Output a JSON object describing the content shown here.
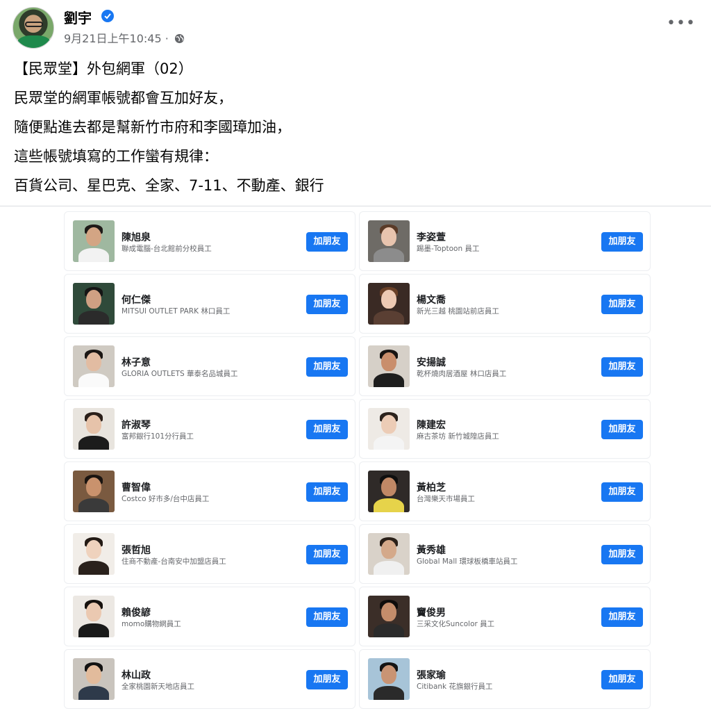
{
  "post": {
    "author": "劉宇",
    "timestamp": "9月21日上午10:45 ·",
    "lines": [
      "【民眾堂】外包網軍（02）",
      "民眾堂的網軍帳號都會互加好友，",
      "隨便點進去都是幫新竹市府和李國璋加油，",
      "這些帳號填寫的工作蠻有規律：",
      "百貨公司、星巴克、全家、7-11、不動產、銀行"
    ]
  },
  "colors": {
    "accent": "#1877f2",
    "text": "#050505",
    "muted": "#65676b"
  },
  "icons": {
    "verified": "verified-badge-icon",
    "privacy": "globe-icon",
    "menu": "more-options-icon"
  },
  "friends": [
    {
      "name": "陳旭泉",
      "job": "聯成電腦-台北館前分校員工",
      "button": "加朋友"
    },
    {
      "name": "李姿萱",
      "job": "踢墨-Toptoon 員工",
      "button": "加朋友"
    },
    {
      "name": "何仁傑",
      "job": "MITSUI OUTLET PARK 林口員工",
      "button": "加朋友"
    },
    {
      "name": "楊文喬",
      "job": "新光三越 桃園站前店員工",
      "button": "加朋友"
    },
    {
      "name": "林子意",
      "job": "GLORIA OUTLETS 華泰名品城員工",
      "button": "加朋友"
    },
    {
      "name": "安揚誠",
      "job": "乾杯燒肉居酒屋 林口店員工",
      "button": "加朋友"
    },
    {
      "name": "許淑琴",
      "job": "富邦銀行101分行員工",
      "button": "加朋友"
    },
    {
      "name": "陳建宏",
      "job": "麻古茶坊 新竹城隍店員工",
      "button": "加朋友"
    },
    {
      "name": "曹智偉",
      "job": "Costco 好市多/台中店員工",
      "button": "加朋友"
    },
    {
      "name": "黃柏芝",
      "job": "台灣樂天市場員工",
      "button": "加朋友"
    },
    {
      "name": "張哲旭",
      "job": "住商不動產-台南安中加盟店員工",
      "button": "加朋友"
    },
    {
      "name": "黃秀雄",
      "job": "Global Mall 環球板橋車站員工",
      "button": "加朋友"
    },
    {
      "name": "賴俊諺",
      "job": "momo購物網員工",
      "button": "加朋友"
    },
    {
      "name": "竇俊男",
      "job": "三采文化Suncolor 員工",
      "button": "加朋友"
    },
    {
      "name": "林山政",
      "job": "全家桃園新天地店員工",
      "button": "加朋友"
    },
    {
      "name": "張家瑜",
      "job": "Citibank 花旗銀行員工",
      "button": "加朋友"
    }
  ]
}
